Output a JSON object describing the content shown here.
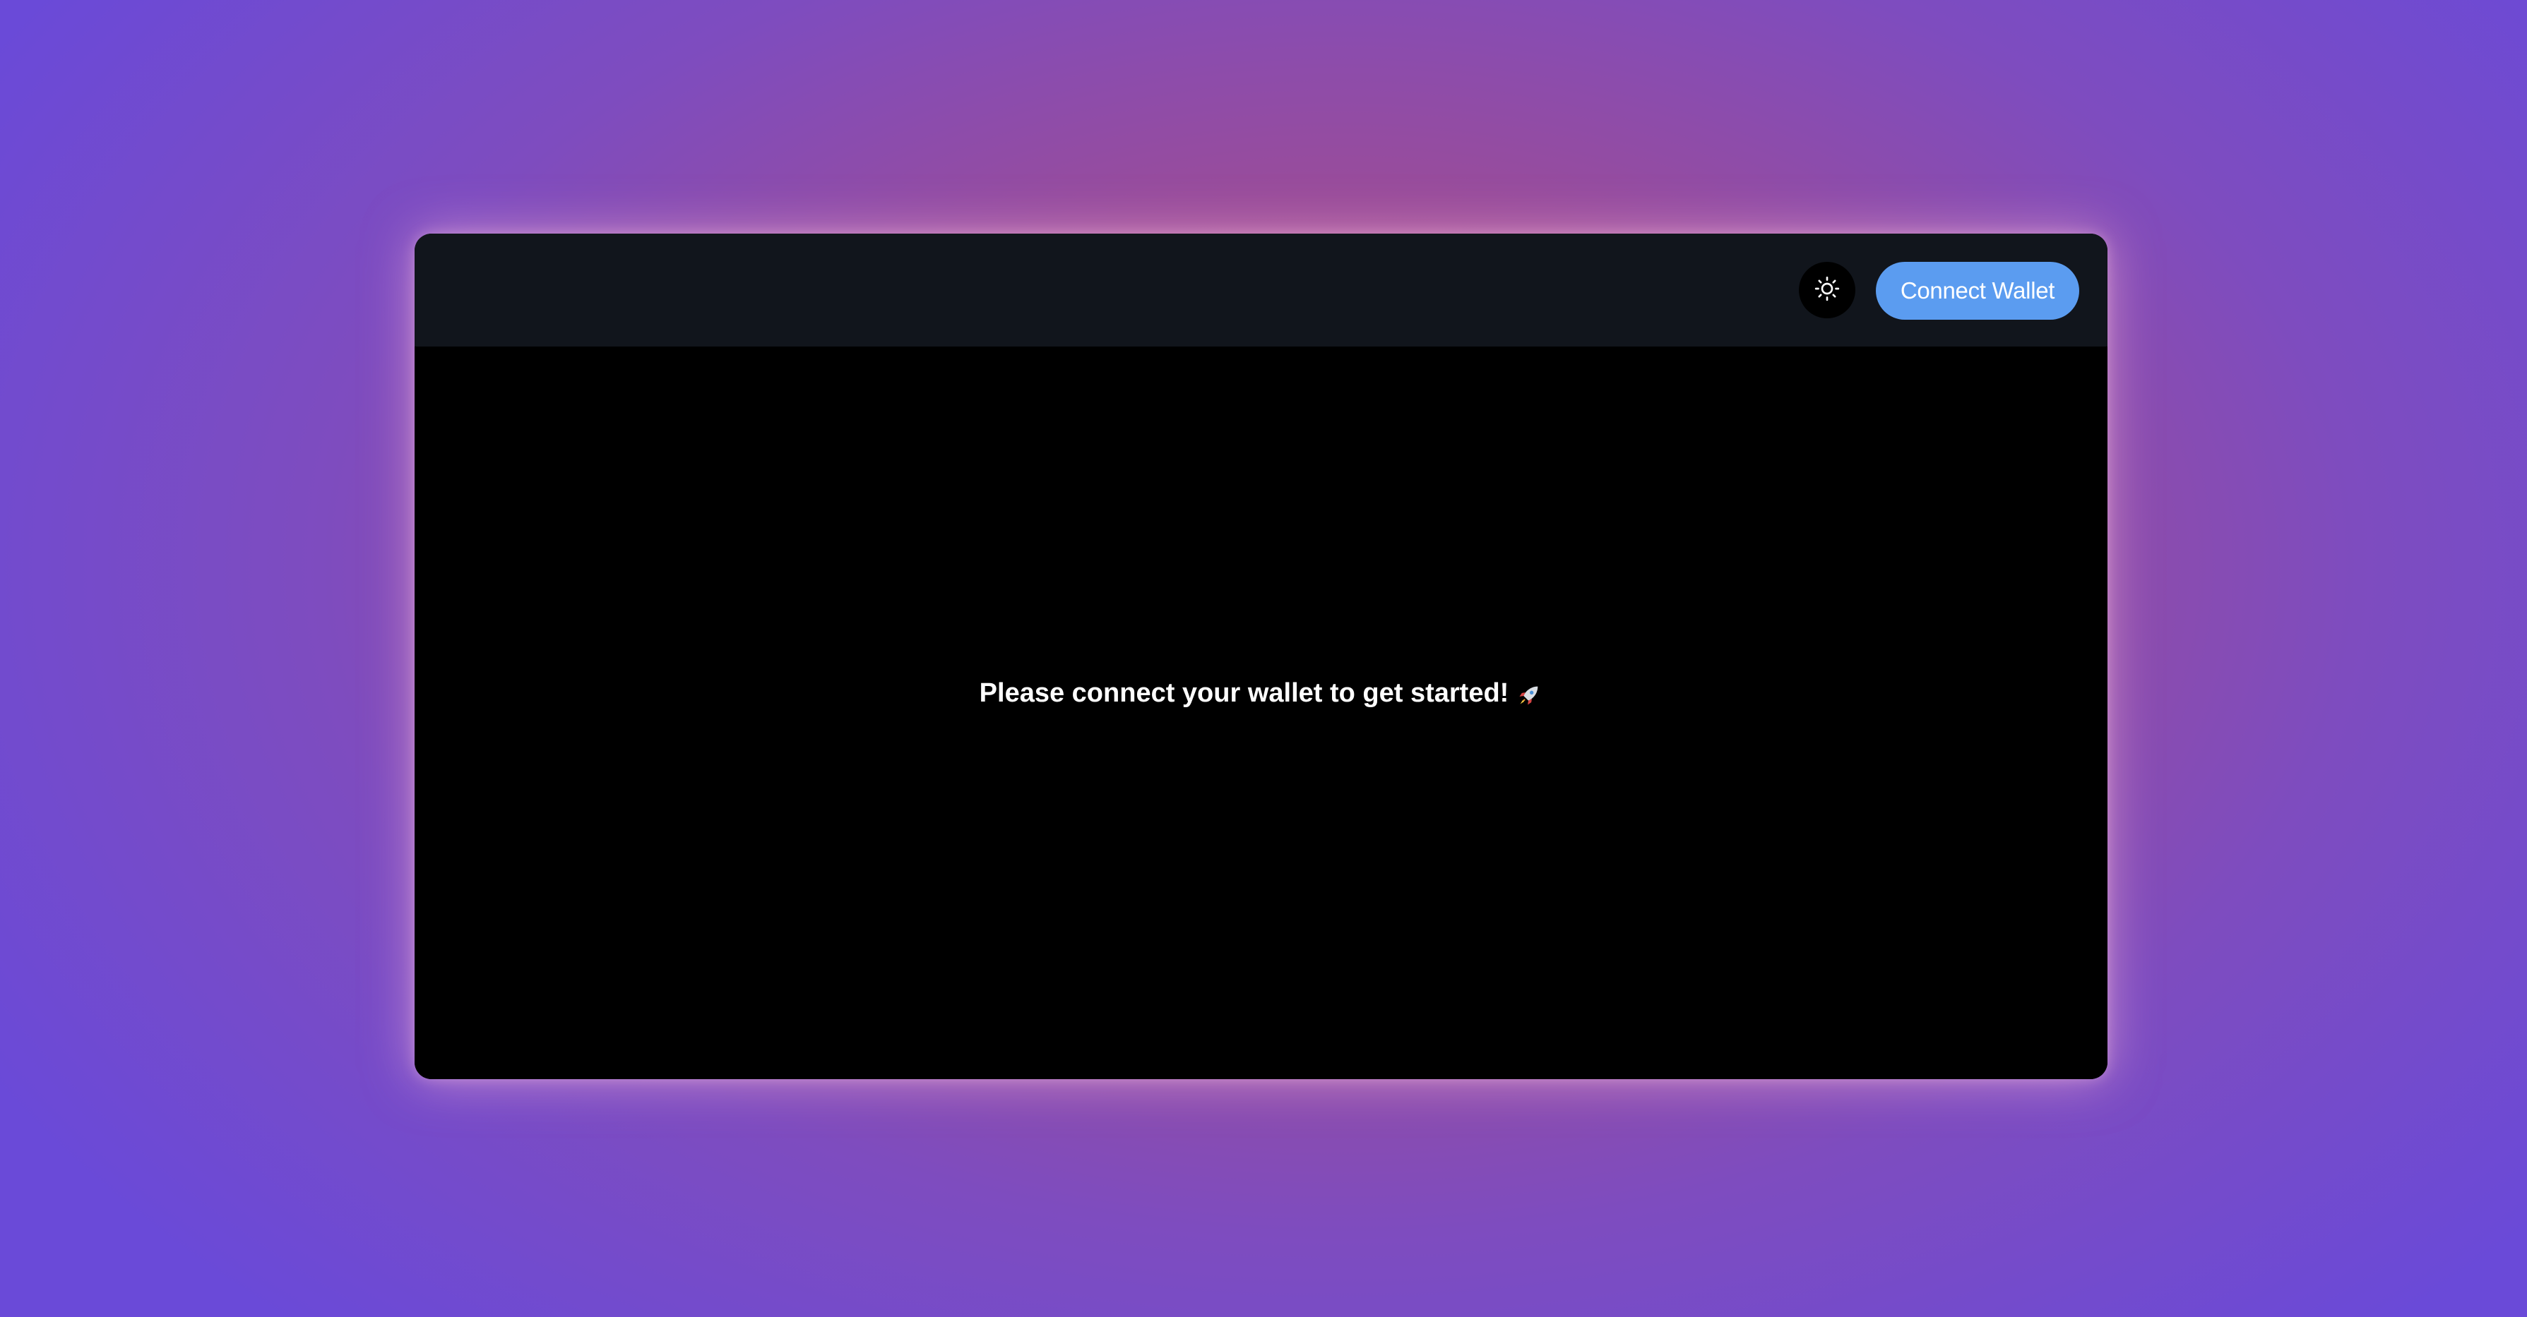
{
  "header": {
    "theme_toggle_icon": "sun-icon",
    "connect_button_label": "Connect Wallet"
  },
  "main": {
    "prompt": "Please connect your wallet to get started!",
    "prompt_icon": "rocket-icon"
  },
  "colors": {
    "accent": "#5b9cf0",
    "header_bg": "#11151c",
    "content_bg": "#000000",
    "text": "#ffffff"
  }
}
